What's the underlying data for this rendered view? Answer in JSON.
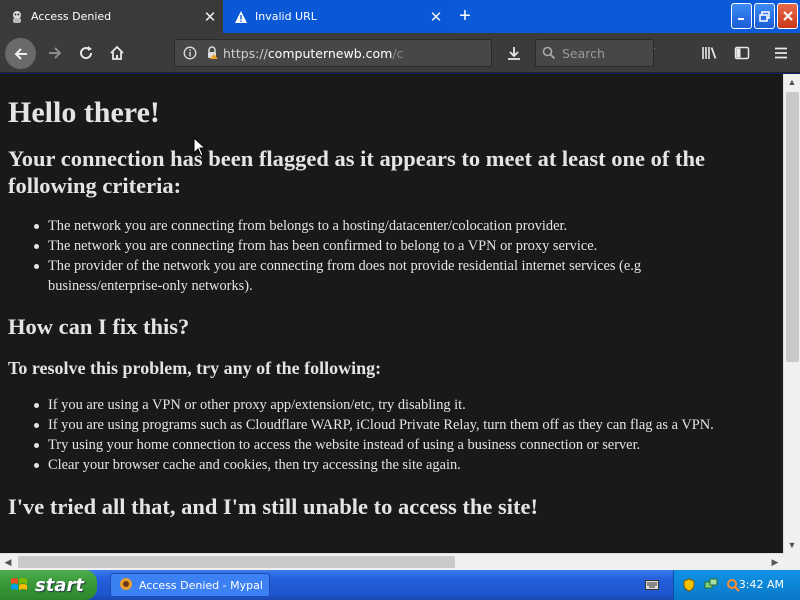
{
  "tabs": [
    {
      "label": "Access Denied",
      "active": true,
      "icon": "site-favicon"
    },
    {
      "label": "Invalid URL",
      "active": false,
      "icon": "warning-icon"
    }
  ],
  "navbar": {
    "url_scheme": "https://",
    "url_host": "computernewb.com",
    "url_tail": "/col",
    "search_placeholder": "Search"
  },
  "page": {
    "heading": "Hello there!",
    "flag_heading": "Your connection has been flagged as it appears to meet at least one of the following criteria:",
    "criteria": [
      "The network you are connecting from belongs to a hosting/datacenter/colocation provider.",
      "The network you are connecting from has been confirmed to belong to a VPN or proxy service.",
      "The provider of the network you are connecting from does not provide residential internet services (e.g business/enterprise-only networks)."
    ],
    "fix_heading": "How can I fix this?",
    "resolve_heading": "To resolve this problem, try any of the following:",
    "steps": [
      "If you are using a VPN or other proxy app/extension/etc, try disabling it.",
      "If you are using programs such as Cloudflare WARP, iCloud Private Relay, turn them off as they can flag as a VPN.",
      "Try using your home connection to access the website instead of using a business connection or server.",
      "Clear your browser cache and cookies, then try accessing the site again."
    ],
    "still_heading": "I've tried all that, and I'm still unable to access the site!"
  },
  "taskbar": {
    "start_label": "start",
    "task_label": "Access Denied - Mypal",
    "clock": "3:42 AM"
  },
  "colors": {
    "tab_strip": "#0c5ad8",
    "active_tab": "#3a3a3a",
    "toolbar": "#3b3b3b",
    "page_bg": "#181a19",
    "page_text": "#e4e4e4"
  }
}
